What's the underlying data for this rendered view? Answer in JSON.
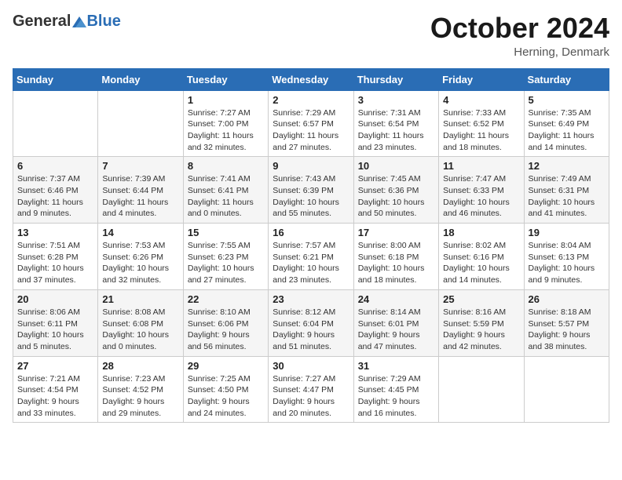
{
  "header": {
    "logo_general": "General",
    "logo_blue": "Blue",
    "month": "October 2024",
    "location": "Herning, Denmark"
  },
  "weekdays": [
    "Sunday",
    "Monday",
    "Tuesday",
    "Wednesday",
    "Thursday",
    "Friday",
    "Saturday"
  ],
  "weeks": [
    [
      {
        "day": "",
        "sunrise": "",
        "sunset": "",
        "daylight": ""
      },
      {
        "day": "",
        "sunrise": "",
        "sunset": "",
        "daylight": ""
      },
      {
        "day": "1",
        "sunrise": "Sunrise: 7:27 AM",
        "sunset": "Sunset: 7:00 PM",
        "daylight": "Daylight: 11 hours and 32 minutes."
      },
      {
        "day": "2",
        "sunrise": "Sunrise: 7:29 AM",
        "sunset": "Sunset: 6:57 PM",
        "daylight": "Daylight: 11 hours and 27 minutes."
      },
      {
        "day": "3",
        "sunrise": "Sunrise: 7:31 AM",
        "sunset": "Sunset: 6:54 PM",
        "daylight": "Daylight: 11 hours and 23 minutes."
      },
      {
        "day": "4",
        "sunrise": "Sunrise: 7:33 AM",
        "sunset": "Sunset: 6:52 PM",
        "daylight": "Daylight: 11 hours and 18 minutes."
      },
      {
        "day": "5",
        "sunrise": "Sunrise: 7:35 AM",
        "sunset": "Sunset: 6:49 PM",
        "daylight": "Daylight: 11 hours and 14 minutes."
      }
    ],
    [
      {
        "day": "6",
        "sunrise": "Sunrise: 7:37 AM",
        "sunset": "Sunset: 6:46 PM",
        "daylight": "Daylight: 11 hours and 9 minutes."
      },
      {
        "day": "7",
        "sunrise": "Sunrise: 7:39 AM",
        "sunset": "Sunset: 6:44 PM",
        "daylight": "Daylight: 11 hours and 4 minutes."
      },
      {
        "day": "8",
        "sunrise": "Sunrise: 7:41 AM",
        "sunset": "Sunset: 6:41 PM",
        "daylight": "Daylight: 11 hours and 0 minutes."
      },
      {
        "day": "9",
        "sunrise": "Sunrise: 7:43 AM",
        "sunset": "Sunset: 6:39 PM",
        "daylight": "Daylight: 10 hours and 55 minutes."
      },
      {
        "day": "10",
        "sunrise": "Sunrise: 7:45 AM",
        "sunset": "Sunset: 6:36 PM",
        "daylight": "Daylight: 10 hours and 50 minutes."
      },
      {
        "day": "11",
        "sunrise": "Sunrise: 7:47 AM",
        "sunset": "Sunset: 6:33 PM",
        "daylight": "Daylight: 10 hours and 46 minutes."
      },
      {
        "day": "12",
        "sunrise": "Sunrise: 7:49 AM",
        "sunset": "Sunset: 6:31 PM",
        "daylight": "Daylight: 10 hours and 41 minutes."
      }
    ],
    [
      {
        "day": "13",
        "sunrise": "Sunrise: 7:51 AM",
        "sunset": "Sunset: 6:28 PM",
        "daylight": "Daylight: 10 hours and 37 minutes."
      },
      {
        "day": "14",
        "sunrise": "Sunrise: 7:53 AM",
        "sunset": "Sunset: 6:26 PM",
        "daylight": "Daylight: 10 hours and 32 minutes."
      },
      {
        "day": "15",
        "sunrise": "Sunrise: 7:55 AM",
        "sunset": "Sunset: 6:23 PM",
        "daylight": "Daylight: 10 hours and 27 minutes."
      },
      {
        "day": "16",
        "sunrise": "Sunrise: 7:57 AM",
        "sunset": "Sunset: 6:21 PM",
        "daylight": "Daylight: 10 hours and 23 minutes."
      },
      {
        "day": "17",
        "sunrise": "Sunrise: 8:00 AM",
        "sunset": "Sunset: 6:18 PM",
        "daylight": "Daylight: 10 hours and 18 minutes."
      },
      {
        "day": "18",
        "sunrise": "Sunrise: 8:02 AM",
        "sunset": "Sunset: 6:16 PM",
        "daylight": "Daylight: 10 hours and 14 minutes."
      },
      {
        "day": "19",
        "sunrise": "Sunrise: 8:04 AM",
        "sunset": "Sunset: 6:13 PM",
        "daylight": "Daylight: 10 hours and 9 minutes."
      }
    ],
    [
      {
        "day": "20",
        "sunrise": "Sunrise: 8:06 AM",
        "sunset": "Sunset: 6:11 PM",
        "daylight": "Daylight: 10 hours and 5 minutes."
      },
      {
        "day": "21",
        "sunrise": "Sunrise: 8:08 AM",
        "sunset": "Sunset: 6:08 PM",
        "daylight": "Daylight: 10 hours and 0 minutes."
      },
      {
        "day": "22",
        "sunrise": "Sunrise: 8:10 AM",
        "sunset": "Sunset: 6:06 PM",
        "daylight": "Daylight: 9 hours and 56 minutes."
      },
      {
        "day": "23",
        "sunrise": "Sunrise: 8:12 AM",
        "sunset": "Sunset: 6:04 PM",
        "daylight": "Daylight: 9 hours and 51 minutes."
      },
      {
        "day": "24",
        "sunrise": "Sunrise: 8:14 AM",
        "sunset": "Sunset: 6:01 PM",
        "daylight": "Daylight: 9 hours and 47 minutes."
      },
      {
        "day": "25",
        "sunrise": "Sunrise: 8:16 AM",
        "sunset": "Sunset: 5:59 PM",
        "daylight": "Daylight: 9 hours and 42 minutes."
      },
      {
        "day": "26",
        "sunrise": "Sunrise: 8:18 AM",
        "sunset": "Sunset: 5:57 PM",
        "daylight": "Daylight: 9 hours and 38 minutes."
      }
    ],
    [
      {
        "day": "27",
        "sunrise": "Sunrise: 7:21 AM",
        "sunset": "Sunset: 4:54 PM",
        "daylight": "Daylight: 9 hours and 33 minutes."
      },
      {
        "day": "28",
        "sunrise": "Sunrise: 7:23 AM",
        "sunset": "Sunset: 4:52 PM",
        "daylight": "Daylight: 9 hours and 29 minutes."
      },
      {
        "day": "29",
        "sunrise": "Sunrise: 7:25 AM",
        "sunset": "Sunset: 4:50 PM",
        "daylight": "Daylight: 9 hours and 24 minutes."
      },
      {
        "day": "30",
        "sunrise": "Sunrise: 7:27 AM",
        "sunset": "Sunset: 4:47 PM",
        "daylight": "Daylight: 9 hours and 20 minutes."
      },
      {
        "day": "31",
        "sunrise": "Sunrise: 7:29 AM",
        "sunset": "Sunset: 4:45 PM",
        "daylight": "Daylight: 9 hours and 16 minutes."
      },
      {
        "day": "",
        "sunrise": "",
        "sunset": "",
        "daylight": ""
      },
      {
        "day": "",
        "sunrise": "",
        "sunset": "",
        "daylight": ""
      }
    ]
  ]
}
